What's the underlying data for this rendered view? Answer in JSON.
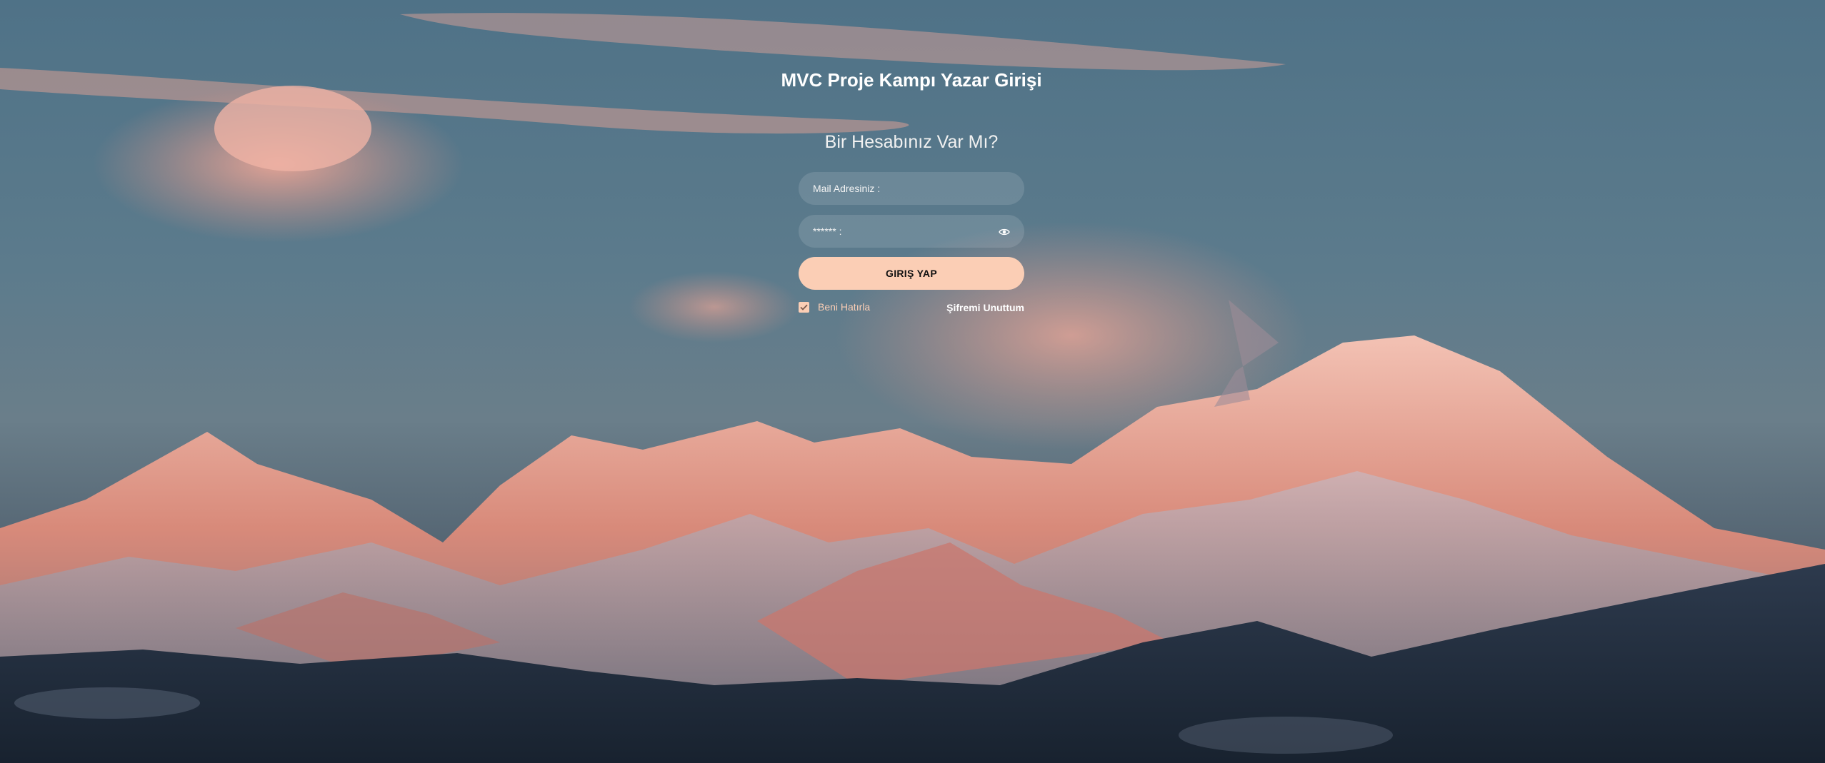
{
  "login": {
    "title": "MVC Proje Kampı Yazar Girişi",
    "subtitle": "Bir Hesabınız Var Mı?",
    "email_placeholder": "Mail Adresiniz :",
    "password_placeholder": "****** :",
    "password_toggle_icon": "eye-icon",
    "submit_label": "GIRIŞ YAP",
    "remember_label": "Beni Hatırla",
    "remember_checked": true,
    "forgot_label": "Şifremi Unuttum"
  },
  "colors": {
    "accent": "#fbceb5",
    "text": "#ffffff"
  }
}
